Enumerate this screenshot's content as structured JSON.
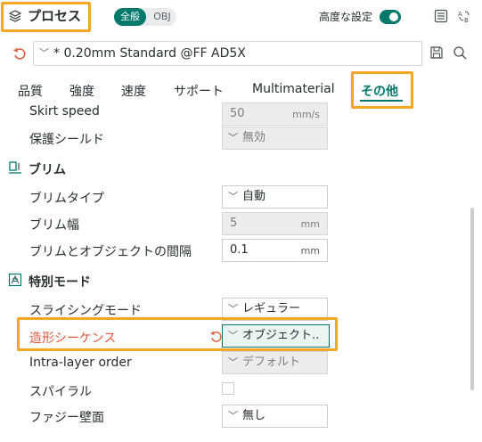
{
  "topbar": {
    "process_label": "プロセス",
    "scope_all": "全般",
    "scope_obj": "OBJ",
    "advanced_label": "高度な設定"
  },
  "preset": {
    "name": "* 0.20mm Standard @FF AD5X"
  },
  "tabs": [
    {
      "label": "品質"
    },
    {
      "label": "強度"
    },
    {
      "label": "速度"
    },
    {
      "label": "サポート"
    },
    {
      "label": "Multimaterial"
    },
    {
      "label": "その他",
      "active": true
    }
  ],
  "rows": {
    "skirt_speed": {
      "label": "Skirt speed",
      "value": "50",
      "unit": "mm/s"
    },
    "shield": {
      "label": "保護シールド",
      "value": "無効"
    },
    "brim_section": {
      "title": "ブリム"
    },
    "brim_type": {
      "label": "ブリムタイプ",
      "value": "自動"
    },
    "brim_width": {
      "label": "ブリム幅",
      "value": "5",
      "unit": "mm"
    },
    "brim_gap": {
      "label": "ブリムとオブジェクトの間隔",
      "value": "0.1",
      "unit": "mm"
    },
    "special_section": {
      "title": "特別モード"
    },
    "slicing_mode": {
      "label": "スライシングモード",
      "value": "レギュラー"
    },
    "print_sequence": {
      "label": "造形シーケンス",
      "value": "オブジェクト.."
    },
    "intra_layer": {
      "label": "Intra-layer order",
      "value": "デフォルト"
    },
    "spiral": {
      "label": "スパイラル",
      "checked": false
    },
    "fuzzy_skin": {
      "label": "ファジー壁面",
      "value": "無し"
    }
  },
  "colors": {
    "accent": "#00796b",
    "highlight": "#f5a623",
    "warning_label": "#e2583a"
  },
  "icons": [
    "layers-icon",
    "list-icon",
    "sync-icon",
    "undo-icon",
    "chevron-down-icon",
    "save-icon",
    "search-icon",
    "brim-icon",
    "special-mode-icon",
    "reset-icon"
  ]
}
